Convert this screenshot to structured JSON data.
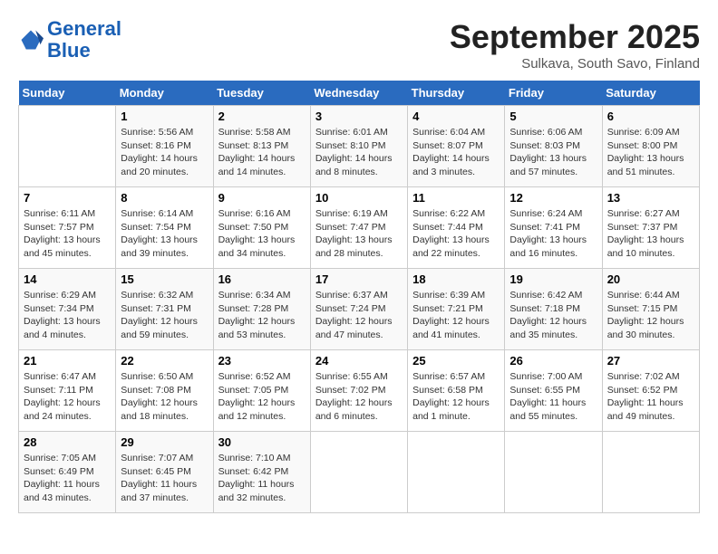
{
  "header": {
    "logo_line1": "General",
    "logo_line2": "Blue",
    "month_title": "September 2025",
    "subtitle": "Sulkava, South Savo, Finland"
  },
  "days_of_week": [
    "Sunday",
    "Monday",
    "Tuesday",
    "Wednesday",
    "Thursday",
    "Friday",
    "Saturday"
  ],
  "weeks": [
    [
      {
        "day": "",
        "info": ""
      },
      {
        "day": "1",
        "info": "Sunrise: 5:56 AM\nSunset: 8:16 PM\nDaylight: 14 hours\nand 20 minutes."
      },
      {
        "day": "2",
        "info": "Sunrise: 5:58 AM\nSunset: 8:13 PM\nDaylight: 14 hours\nand 14 minutes."
      },
      {
        "day": "3",
        "info": "Sunrise: 6:01 AM\nSunset: 8:10 PM\nDaylight: 14 hours\nand 8 minutes."
      },
      {
        "day": "4",
        "info": "Sunrise: 6:04 AM\nSunset: 8:07 PM\nDaylight: 14 hours\nand 3 minutes."
      },
      {
        "day": "5",
        "info": "Sunrise: 6:06 AM\nSunset: 8:03 PM\nDaylight: 13 hours\nand 57 minutes."
      },
      {
        "day": "6",
        "info": "Sunrise: 6:09 AM\nSunset: 8:00 PM\nDaylight: 13 hours\nand 51 minutes."
      }
    ],
    [
      {
        "day": "7",
        "info": "Sunrise: 6:11 AM\nSunset: 7:57 PM\nDaylight: 13 hours\nand 45 minutes."
      },
      {
        "day": "8",
        "info": "Sunrise: 6:14 AM\nSunset: 7:54 PM\nDaylight: 13 hours\nand 39 minutes."
      },
      {
        "day": "9",
        "info": "Sunrise: 6:16 AM\nSunset: 7:50 PM\nDaylight: 13 hours\nand 34 minutes."
      },
      {
        "day": "10",
        "info": "Sunrise: 6:19 AM\nSunset: 7:47 PM\nDaylight: 13 hours\nand 28 minutes."
      },
      {
        "day": "11",
        "info": "Sunrise: 6:22 AM\nSunset: 7:44 PM\nDaylight: 13 hours\nand 22 minutes."
      },
      {
        "day": "12",
        "info": "Sunrise: 6:24 AM\nSunset: 7:41 PM\nDaylight: 13 hours\nand 16 minutes."
      },
      {
        "day": "13",
        "info": "Sunrise: 6:27 AM\nSunset: 7:37 PM\nDaylight: 13 hours\nand 10 minutes."
      }
    ],
    [
      {
        "day": "14",
        "info": "Sunrise: 6:29 AM\nSunset: 7:34 PM\nDaylight: 13 hours\nand 4 minutes."
      },
      {
        "day": "15",
        "info": "Sunrise: 6:32 AM\nSunset: 7:31 PM\nDaylight: 12 hours\nand 59 minutes."
      },
      {
        "day": "16",
        "info": "Sunrise: 6:34 AM\nSunset: 7:28 PM\nDaylight: 12 hours\nand 53 minutes."
      },
      {
        "day": "17",
        "info": "Sunrise: 6:37 AM\nSunset: 7:24 PM\nDaylight: 12 hours\nand 47 minutes."
      },
      {
        "day": "18",
        "info": "Sunrise: 6:39 AM\nSunset: 7:21 PM\nDaylight: 12 hours\nand 41 minutes."
      },
      {
        "day": "19",
        "info": "Sunrise: 6:42 AM\nSunset: 7:18 PM\nDaylight: 12 hours\nand 35 minutes."
      },
      {
        "day": "20",
        "info": "Sunrise: 6:44 AM\nSunset: 7:15 PM\nDaylight: 12 hours\nand 30 minutes."
      }
    ],
    [
      {
        "day": "21",
        "info": "Sunrise: 6:47 AM\nSunset: 7:11 PM\nDaylight: 12 hours\nand 24 minutes."
      },
      {
        "day": "22",
        "info": "Sunrise: 6:50 AM\nSunset: 7:08 PM\nDaylight: 12 hours\nand 18 minutes."
      },
      {
        "day": "23",
        "info": "Sunrise: 6:52 AM\nSunset: 7:05 PM\nDaylight: 12 hours\nand 12 minutes."
      },
      {
        "day": "24",
        "info": "Sunrise: 6:55 AM\nSunset: 7:02 PM\nDaylight: 12 hours\nand 6 minutes."
      },
      {
        "day": "25",
        "info": "Sunrise: 6:57 AM\nSunset: 6:58 PM\nDaylight: 12 hours\nand 1 minute."
      },
      {
        "day": "26",
        "info": "Sunrise: 7:00 AM\nSunset: 6:55 PM\nDaylight: 11 hours\nand 55 minutes."
      },
      {
        "day": "27",
        "info": "Sunrise: 7:02 AM\nSunset: 6:52 PM\nDaylight: 11 hours\nand 49 minutes."
      }
    ],
    [
      {
        "day": "28",
        "info": "Sunrise: 7:05 AM\nSunset: 6:49 PM\nDaylight: 11 hours\nand 43 minutes."
      },
      {
        "day": "29",
        "info": "Sunrise: 7:07 AM\nSunset: 6:45 PM\nDaylight: 11 hours\nand 37 minutes."
      },
      {
        "day": "30",
        "info": "Sunrise: 7:10 AM\nSunset: 6:42 PM\nDaylight: 11 hours\nand 32 minutes."
      },
      {
        "day": "",
        "info": ""
      },
      {
        "day": "",
        "info": ""
      },
      {
        "day": "",
        "info": ""
      },
      {
        "day": "",
        "info": ""
      }
    ]
  ]
}
